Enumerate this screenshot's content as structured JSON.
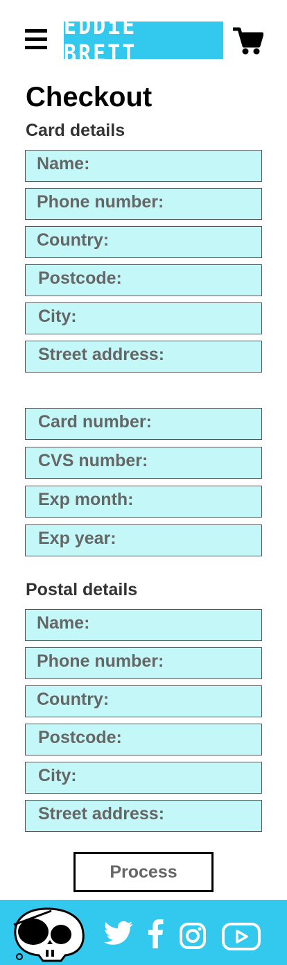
{
  "header": {
    "logo_text": "EDDiE BRETT",
    "menu_icon": "hamburger-menu-icon",
    "cart_icon": "shopping-cart-icon",
    "brand_color": "#33c8ee"
  },
  "page": {
    "title": "Checkout"
  },
  "card_section": {
    "title": "Card details",
    "fields": [
      {
        "label": "Name:"
      },
      {
        "label": "Phone number:"
      },
      {
        "label": "Country:"
      },
      {
        "label": "Postcode:"
      },
      {
        "label": "City:"
      },
      {
        "label": "Street address:"
      }
    ],
    "card_fields": [
      {
        "label": "Card number:"
      },
      {
        "label": "CVS number:"
      },
      {
        "label": "Exp month:"
      },
      {
        "label": "Exp year:"
      }
    ]
  },
  "postal_section": {
    "title": "Postal details",
    "fields": [
      {
        "label": "Name:"
      },
      {
        "label": "Phone number:"
      },
      {
        "label": "Country:"
      },
      {
        "label": "Postcode:"
      },
      {
        "label": "City:"
      },
      {
        "label": "Street address:"
      }
    ]
  },
  "actions": {
    "process_label": "Process"
  },
  "footer": {
    "mascot": "pirate-skull-mascot",
    "social_icons": [
      "twitter-icon",
      "facebook-icon",
      "instagram-icon",
      "youtube-icon"
    ],
    "field_color": "#c4f8f8"
  }
}
